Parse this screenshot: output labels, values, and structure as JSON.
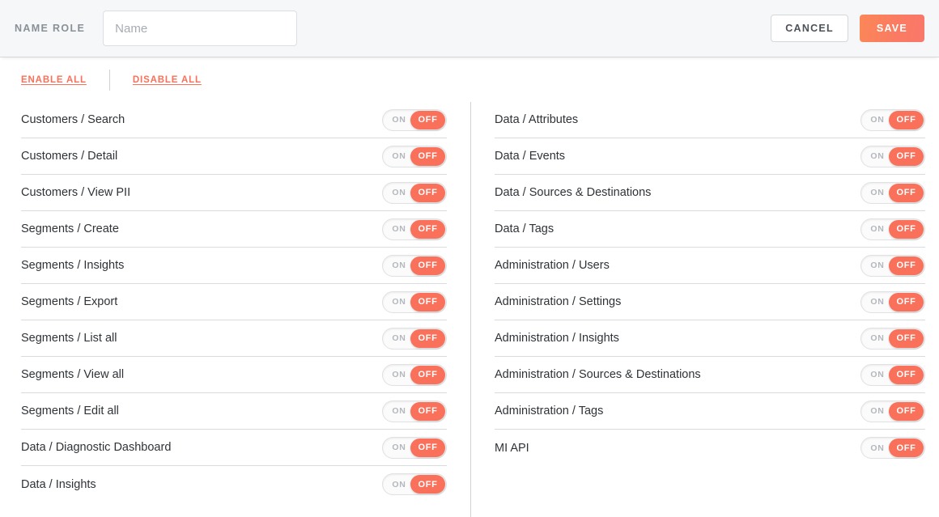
{
  "header": {
    "name_role_label": "NAME ROLE",
    "name_input_value": "",
    "name_input_placeholder": "Name",
    "cancel_label": "CANCEL",
    "save_label": "SAVE",
    "save_color": "#fa7b62",
    "label_color": "#8a9097"
  },
  "bulk_actions": {
    "enable_all_label": "ENABLE ALL",
    "disable_all_label": "DISABLE ALL",
    "link_color": "#f9705b"
  },
  "toggle": {
    "on_label": "ON",
    "off_label": "OFF",
    "off_color": "#f9705b",
    "track_color": "#fbfbfb"
  },
  "permissions": {
    "left_column": [
      {
        "label": "Customers / Search",
        "state": "OFF"
      },
      {
        "label": "Customers / Detail",
        "state": "OFF"
      },
      {
        "label": "Customers / View PII",
        "state": "OFF"
      },
      {
        "label": "Segments / Create",
        "state": "OFF"
      },
      {
        "label": "Segments / Insights",
        "state": "OFF"
      },
      {
        "label": "Segments / Export",
        "state": "OFF"
      },
      {
        "label": "Segments / List all",
        "state": "OFF"
      },
      {
        "label": "Segments / View all",
        "state": "OFF"
      },
      {
        "label": "Segments / Edit all",
        "state": "OFF"
      },
      {
        "label": "Data / Diagnostic Dashboard",
        "state": "OFF"
      },
      {
        "label": "Data / Insights",
        "state": "OFF"
      }
    ],
    "right_column": [
      {
        "label": "Data / Attributes",
        "state": "OFF"
      },
      {
        "label": "Data / Events",
        "state": "OFF"
      },
      {
        "label": "Data / Sources & Destinations",
        "state": "OFF"
      },
      {
        "label": "Data / Tags",
        "state": "OFF"
      },
      {
        "label": "Administration / Users",
        "state": "OFF"
      },
      {
        "label": "Administration / Settings",
        "state": "OFF"
      },
      {
        "label": "Administration / Insights",
        "state": "OFF"
      },
      {
        "label": "Administration / Sources & Destinations",
        "state": "OFF"
      },
      {
        "label": "Administration / Tags",
        "state": "OFF"
      },
      {
        "label": "MI API",
        "state": "OFF"
      }
    ]
  }
}
